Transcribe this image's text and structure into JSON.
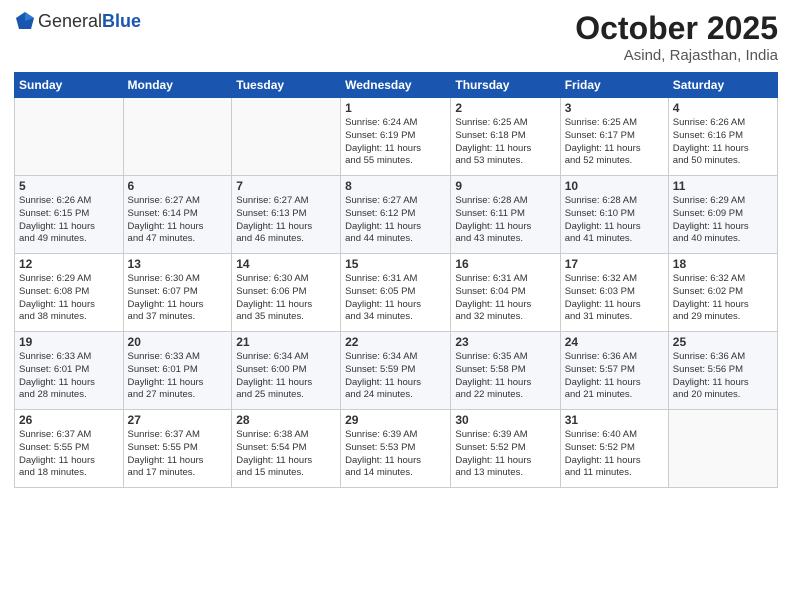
{
  "header": {
    "logo_general": "General",
    "logo_blue": "Blue",
    "month_title": "October 2025",
    "location": "Asind, Rajasthan, India"
  },
  "days_of_week": [
    "Sunday",
    "Monday",
    "Tuesday",
    "Wednesday",
    "Thursday",
    "Friday",
    "Saturday"
  ],
  "weeks": [
    [
      {
        "day": "",
        "info": ""
      },
      {
        "day": "",
        "info": ""
      },
      {
        "day": "",
        "info": ""
      },
      {
        "day": "1",
        "info": "Sunrise: 6:24 AM\nSunset: 6:19 PM\nDaylight: 11 hours\nand 55 minutes."
      },
      {
        "day": "2",
        "info": "Sunrise: 6:25 AM\nSunset: 6:18 PM\nDaylight: 11 hours\nand 53 minutes."
      },
      {
        "day": "3",
        "info": "Sunrise: 6:25 AM\nSunset: 6:17 PM\nDaylight: 11 hours\nand 52 minutes."
      },
      {
        "day": "4",
        "info": "Sunrise: 6:26 AM\nSunset: 6:16 PM\nDaylight: 11 hours\nand 50 minutes."
      }
    ],
    [
      {
        "day": "5",
        "info": "Sunrise: 6:26 AM\nSunset: 6:15 PM\nDaylight: 11 hours\nand 49 minutes."
      },
      {
        "day": "6",
        "info": "Sunrise: 6:27 AM\nSunset: 6:14 PM\nDaylight: 11 hours\nand 47 minutes."
      },
      {
        "day": "7",
        "info": "Sunrise: 6:27 AM\nSunset: 6:13 PM\nDaylight: 11 hours\nand 46 minutes."
      },
      {
        "day": "8",
        "info": "Sunrise: 6:27 AM\nSunset: 6:12 PM\nDaylight: 11 hours\nand 44 minutes."
      },
      {
        "day": "9",
        "info": "Sunrise: 6:28 AM\nSunset: 6:11 PM\nDaylight: 11 hours\nand 43 minutes."
      },
      {
        "day": "10",
        "info": "Sunrise: 6:28 AM\nSunset: 6:10 PM\nDaylight: 11 hours\nand 41 minutes."
      },
      {
        "day": "11",
        "info": "Sunrise: 6:29 AM\nSunset: 6:09 PM\nDaylight: 11 hours\nand 40 minutes."
      }
    ],
    [
      {
        "day": "12",
        "info": "Sunrise: 6:29 AM\nSunset: 6:08 PM\nDaylight: 11 hours\nand 38 minutes."
      },
      {
        "day": "13",
        "info": "Sunrise: 6:30 AM\nSunset: 6:07 PM\nDaylight: 11 hours\nand 37 minutes."
      },
      {
        "day": "14",
        "info": "Sunrise: 6:30 AM\nSunset: 6:06 PM\nDaylight: 11 hours\nand 35 minutes."
      },
      {
        "day": "15",
        "info": "Sunrise: 6:31 AM\nSunset: 6:05 PM\nDaylight: 11 hours\nand 34 minutes."
      },
      {
        "day": "16",
        "info": "Sunrise: 6:31 AM\nSunset: 6:04 PM\nDaylight: 11 hours\nand 32 minutes."
      },
      {
        "day": "17",
        "info": "Sunrise: 6:32 AM\nSunset: 6:03 PM\nDaylight: 11 hours\nand 31 minutes."
      },
      {
        "day": "18",
        "info": "Sunrise: 6:32 AM\nSunset: 6:02 PM\nDaylight: 11 hours\nand 29 minutes."
      }
    ],
    [
      {
        "day": "19",
        "info": "Sunrise: 6:33 AM\nSunset: 6:01 PM\nDaylight: 11 hours\nand 28 minutes."
      },
      {
        "day": "20",
        "info": "Sunrise: 6:33 AM\nSunset: 6:01 PM\nDaylight: 11 hours\nand 27 minutes."
      },
      {
        "day": "21",
        "info": "Sunrise: 6:34 AM\nSunset: 6:00 PM\nDaylight: 11 hours\nand 25 minutes."
      },
      {
        "day": "22",
        "info": "Sunrise: 6:34 AM\nSunset: 5:59 PM\nDaylight: 11 hours\nand 24 minutes."
      },
      {
        "day": "23",
        "info": "Sunrise: 6:35 AM\nSunset: 5:58 PM\nDaylight: 11 hours\nand 22 minutes."
      },
      {
        "day": "24",
        "info": "Sunrise: 6:36 AM\nSunset: 5:57 PM\nDaylight: 11 hours\nand 21 minutes."
      },
      {
        "day": "25",
        "info": "Sunrise: 6:36 AM\nSunset: 5:56 PM\nDaylight: 11 hours\nand 20 minutes."
      }
    ],
    [
      {
        "day": "26",
        "info": "Sunrise: 6:37 AM\nSunset: 5:55 PM\nDaylight: 11 hours\nand 18 minutes."
      },
      {
        "day": "27",
        "info": "Sunrise: 6:37 AM\nSunset: 5:55 PM\nDaylight: 11 hours\nand 17 minutes."
      },
      {
        "day": "28",
        "info": "Sunrise: 6:38 AM\nSunset: 5:54 PM\nDaylight: 11 hours\nand 15 minutes."
      },
      {
        "day": "29",
        "info": "Sunrise: 6:39 AM\nSunset: 5:53 PM\nDaylight: 11 hours\nand 14 minutes."
      },
      {
        "day": "30",
        "info": "Sunrise: 6:39 AM\nSunset: 5:52 PM\nDaylight: 11 hours\nand 13 minutes."
      },
      {
        "day": "31",
        "info": "Sunrise: 6:40 AM\nSunset: 5:52 PM\nDaylight: 11 hours\nand 11 minutes."
      },
      {
        "day": "",
        "info": ""
      }
    ]
  ]
}
